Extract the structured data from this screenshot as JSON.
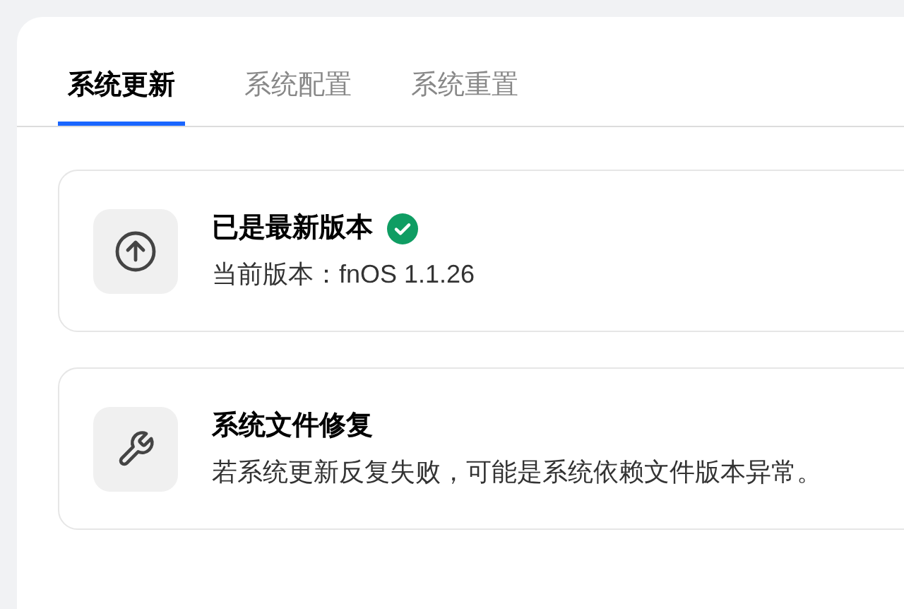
{
  "tabs": [
    {
      "label": "系统更新",
      "selected": true
    },
    {
      "label": "系统配置",
      "selected": false
    },
    {
      "label": "系统重置",
      "selected": false
    }
  ],
  "cards": [
    {
      "kind": "update",
      "title": "已是最新版本",
      "verified": true,
      "description": "当前版本：fnOS 1.1.26"
    },
    {
      "kind": "repair",
      "title": "系统文件修复",
      "verified": false,
      "description": "若系统更新反复失败，可能是系统依赖文件版本异常。"
    }
  ]
}
